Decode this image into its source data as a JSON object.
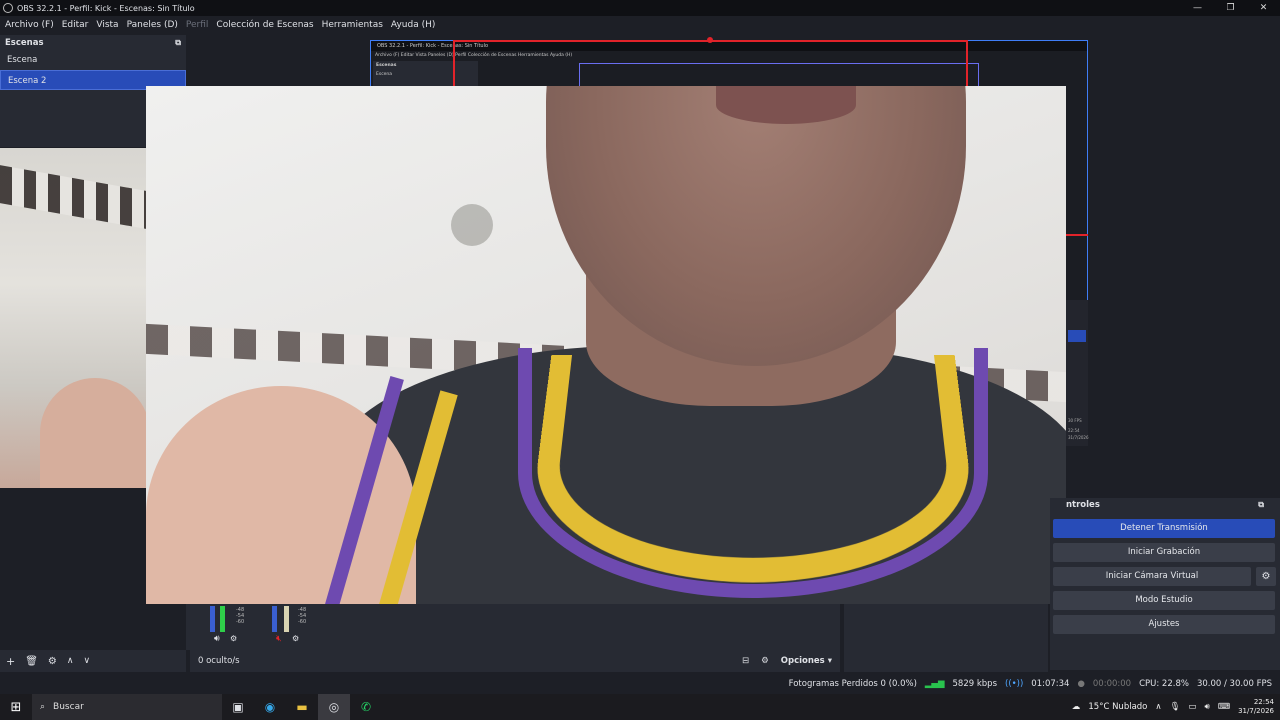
{
  "window": {
    "title": "OBS 32.2.1 - Perfil: Kick - Escenas: Sin Título",
    "ctrl_min": "—",
    "ctrl_max": "❐",
    "ctrl_close": "✕"
  },
  "menu": {
    "items": [
      "Archivo (F)",
      "Editar",
      "Vista",
      "Paneles (D)",
      "Perfil",
      "Colección de Escenas",
      "Herramientas",
      "Ayuda (H)"
    ]
  },
  "scenes": {
    "title": "Escenas",
    "items": [
      "Escena",
      "Escena 2"
    ],
    "selected_index": 1
  },
  "nested": {
    "title": "OBS 32.2.1 - Perfil: Kick - Escenas: Sin Título",
    "menu": "Archivo (F)   Editar   Vista   Paneles (D)   Perfil   Colección de Escenas   Herramientas   Ayuda (H)",
    "scene_hdr": "Escenas",
    "scene_item": "Escena",
    "fps": "30 FPS",
    "time": "22:54",
    "date": "31/7/2026"
  },
  "controls": {
    "title": "ntroles",
    "stop_stream": "Detener Transmisión",
    "start_record": "Iniciar Grabación",
    "start_vcam": "Iniciar Cámara Virtual",
    "studio_mode": "Modo Estudio",
    "settings": "Ajustes"
  },
  "mixer": {
    "scale": [
      "-48",
      "-54",
      "-60"
    ]
  },
  "mix_tools": {
    "hidden": "0 oculto/s",
    "options": "Opciones"
  },
  "status": {
    "dropped": "Fotogramas Perdidos 0 (0.0%)",
    "kbps": "5829 kbps",
    "live_time": "01:07:34",
    "rec_time": "00:00:00",
    "cpu": "CPU: 22.8%",
    "fps": "30.00 / 30.00 FPS"
  },
  "taskbar": {
    "search_placeholder": "Buscar",
    "weather": "15°C  Nublado",
    "time": "22:54",
    "date": "31/7/2026"
  },
  "colors": {
    "accent": "#284cb8",
    "bitrate_green": "#29c34e",
    "live_blue": "#4ea6ff",
    "bounding_red": "#e2232a"
  }
}
